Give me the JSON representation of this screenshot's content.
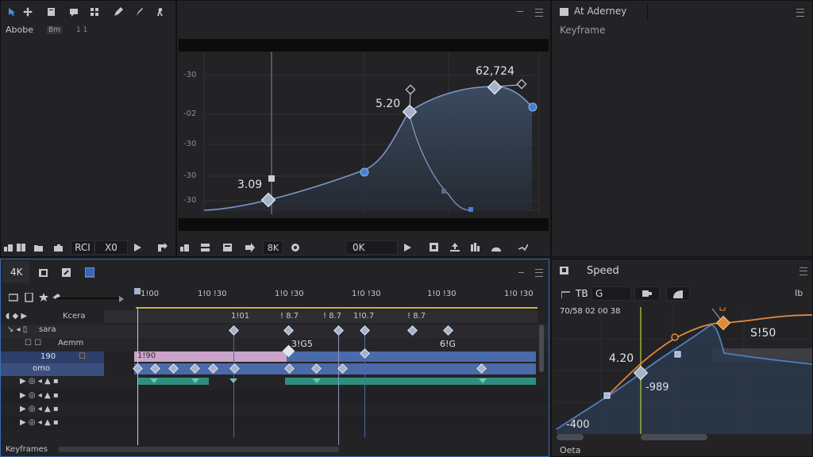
{
  "app": {
    "name": "Abobe",
    "tag1": "Bm",
    "tag2": "1 1"
  },
  "top_panel": {
    "menu_icon": "hamburger-icon",
    "min_icon": "minimize-icon"
  },
  "graph_editor": {
    "y_ticks": [
      "-30",
      "-02",
      "-30",
      "-30",
      "-30"
    ],
    "labels": {
      "a": "3.09",
      "b": "5.20",
      "c": "62,724"
    },
    "controls": {
      "field1": "RCI",
      "field2": "X0",
      "zoom": "0K",
      "b2": "8K"
    },
    "colors": {
      "curve": "#7d98c8",
      "fill": "#34404f",
      "key": "#a6b2c8"
    }
  },
  "right_top": {
    "title": "At Aderney",
    "subtitle": "Keyframe"
  },
  "timeline": {
    "tab": "4K",
    "ruler": [
      "1!00",
      "1!0 !30",
      "1!0 !30",
      "1!0 !30",
      "1!0 !30",
      "1!0 !30"
    ],
    "markers": [
      "1!01",
      "! 8.7",
      "! 8.7",
      "1!0.7",
      "! 8.7"
    ],
    "layers": [
      {
        "name": "Kcera"
      },
      {
        "name": "sara"
      },
      {
        "name": "Aemm"
      },
      {
        "name": "190"
      },
      {
        "name": "omo"
      },
      {
        "name": ""
      },
      {
        "name": ""
      },
      {
        "name": ""
      },
      {
        "name": ""
      }
    ],
    "labels": {
      "a": "3!G5",
      "b": "6!G",
      "c": "1!90"
    },
    "footer": "Keyframes",
    "colors": {
      "pink": "#c9a4c9",
      "blue": "#4b6aa9",
      "teal": "#2f8f7e"
    }
  },
  "speed": {
    "title": "Speed",
    "tb_label": "TB",
    "tb_field": "G",
    "header_values": "70/58 02 00 38",
    "labels": {
      "a": "4.20",
      "b": "-989",
      "c": "S!50",
      "d": "-400"
    },
    "footer": "Oeta",
    "colors": {
      "orange": "#e08a3a",
      "blue": "#4f7fc0",
      "green": "#9fbf3a"
    }
  }
}
